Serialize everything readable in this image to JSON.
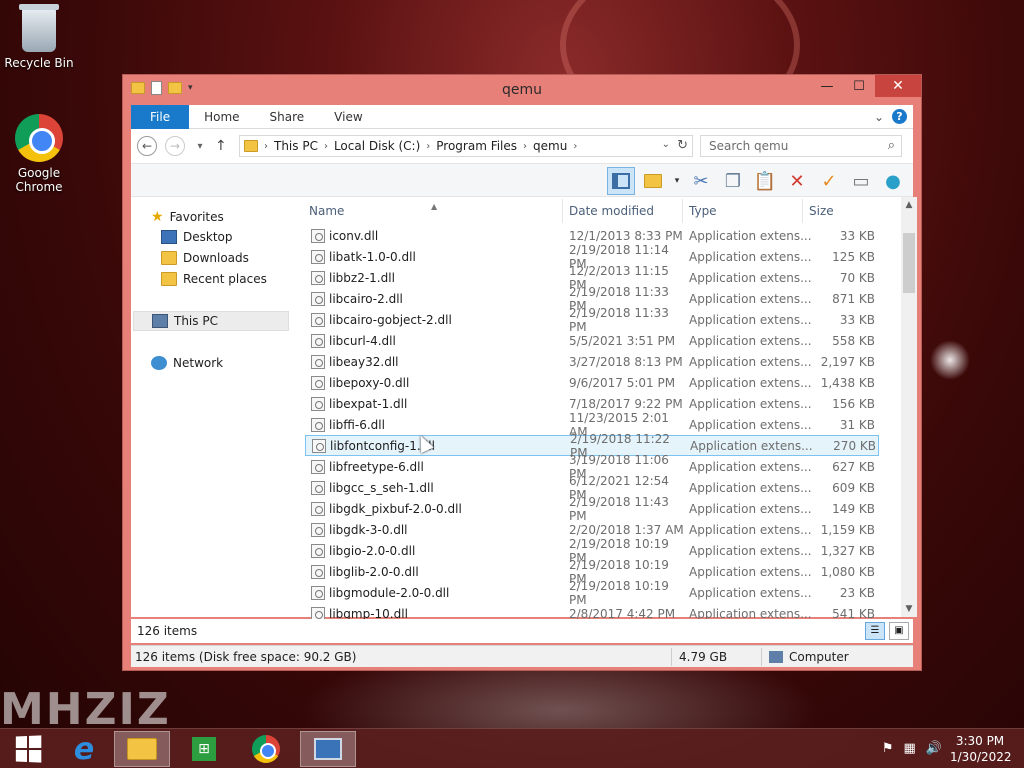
{
  "desktop": {
    "brand_text": "MHZIZ",
    "icons": [
      {
        "label": "Recycle Bin",
        "icon": "recycle-bin-icon"
      },
      {
        "label": "Google Chrome",
        "icon": "chrome-icon"
      }
    ]
  },
  "window": {
    "title": "qemu",
    "controls": {
      "minimize": "—",
      "maximize": "☐",
      "close": "✕"
    },
    "ribbon_tabs": [
      "File",
      "Home",
      "Share",
      "View"
    ],
    "ribbon_expand": "⌄",
    "help": "?",
    "address": {
      "crumbs": [
        "This PC",
        "Local Disk (C:)",
        "Program Files",
        "qemu"
      ]
    },
    "search": {
      "placeholder": "Search qemu"
    },
    "nav_pane": {
      "favorites": "Favorites",
      "favorite_items": [
        "Desktop",
        "Downloads",
        "Recent places"
      ],
      "this_pc": "This PC",
      "network": "Network"
    },
    "columns": {
      "name": "Name",
      "date": "Date modified",
      "type": "Type",
      "size": "Size"
    },
    "files": [
      {
        "name": "iconv.dll",
        "date": "12/1/2013 8:33 PM",
        "type": "Application extens...",
        "size": "33 KB"
      },
      {
        "name": "libatk-1.0-0.dll",
        "date": "2/19/2018 11:14 PM",
        "type": "Application extens...",
        "size": "125 KB"
      },
      {
        "name": "libbz2-1.dll",
        "date": "12/2/2013 11:15 PM",
        "type": "Application extens...",
        "size": "70 KB"
      },
      {
        "name": "libcairo-2.dll",
        "date": "2/19/2018 11:33 PM",
        "type": "Application extens...",
        "size": "871 KB"
      },
      {
        "name": "libcairo-gobject-2.dll",
        "date": "2/19/2018 11:33 PM",
        "type": "Application extens...",
        "size": "33 KB"
      },
      {
        "name": "libcurl-4.dll",
        "date": "5/5/2021 3:51 PM",
        "type": "Application extens...",
        "size": "558 KB"
      },
      {
        "name": "libeay32.dll",
        "date": "3/27/2018 8:13 PM",
        "type": "Application extens...",
        "size": "2,197 KB"
      },
      {
        "name": "libepoxy-0.dll",
        "date": "9/6/2017 5:01 PM",
        "type": "Application extens...",
        "size": "1,438 KB"
      },
      {
        "name": "libexpat-1.dll",
        "date": "7/18/2017 9:22 PM",
        "type": "Application extens...",
        "size": "156 KB"
      },
      {
        "name": "libffi-6.dll",
        "date": "11/23/2015 2:01 AM",
        "type": "Application extens...",
        "size": "31 KB"
      },
      {
        "name": "libfontconfig-1.dll",
        "date": "2/19/2018 11:22 PM",
        "type": "Application extens...",
        "size": "270 KB"
      },
      {
        "name": "libfreetype-6.dll",
        "date": "3/19/2018 11:06 PM",
        "type": "Application extens...",
        "size": "627 KB"
      },
      {
        "name": "libgcc_s_seh-1.dll",
        "date": "6/12/2021 12:54 PM",
        "type": "Application extens...",
        "size": "609 KB"
      },
      {
        "name": "libgdk_pixbuf-2.0-0.dll",
        "date": "2/19/2018 11:43 PM",
        "type": "Application extens...",
        "size": "149 KB"
      },
      {
        "name": "libgdk-3-0.dll",
        "date": "2/20/2018 1:37 AM",
        "type": "Application extens...",
        "size": "1,159 KB"
      },
      {
        "name": "libgio-2.0-0.dll",
        "date": "2/19/2018 10:19 PM",
        "type": "Application extens...",
        "size": "1,327 KB"
      },
      {
        "name": "libglib-2.0-0.dll",
        "date": "2/19/2018 10:19 PM",
        "type": "Application extens...",
        "size": "1,080 KB"
      },
      {
        "name": "libgmodule-2.0-0.dll",
        "date": "2/19/2018 10:19 PM",
        "type": "Application extens...",
        "size": "23 KB"
      },
      {
        "name": "libgmp-10.dll",
        "date": "2/8/2017 4:42 PM",
        "type": "Application extens...",
        "size": "541 KB"
      }
    ],
    "selected_file": "libfontconfig-1.dll",
    "status": {
      "item_count": "126 items",
      "details": "126 items (Disk free space: 90.2 GB)",
      "total_size": "4.79 GB",
      "location": "Computer"
    }
  },
  "taskbar": {
    "apps": [
      "start-icon",
      "internet-explorer-icon",
      "file-explorer-icon",
      "store-icon",
      "chrome-icon",
      "remote-desktop-icon"
    ],
    "clock": {
      "time": "3:30 PM",
      "date": "1/30/2022"
    }
  }
}
